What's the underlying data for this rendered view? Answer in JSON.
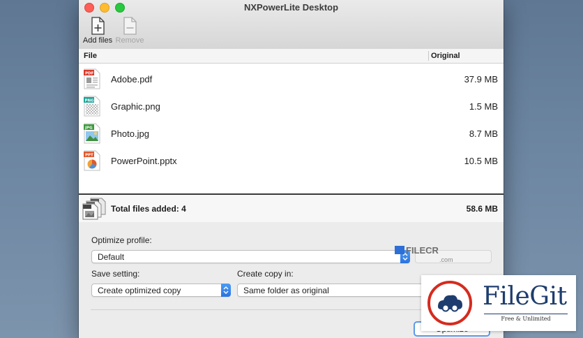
{
  "window": {
    "title": "NXPowerLite Desktop"
  },
  "toolbar": {
    "add_label": "Add files",
    "remove_label": "Remove"
  },
  "columns": {
    "file": "File",
    "original": "Original"
  },
  "files": [
    {
      "name": "Adobe.pdf",
      "size": "37.9 MB",
      "type": "PDF",
      "color": "#d93a2b"
    },
    {
      "name": "Graphic.png",
      "size": "1.5 MB",
      "type": "PNG",
      "color": "#1aa59a"
    },
    {
      "name": "Photo.jpg",
      "size": "8.7 MB",
      "type": "JPG",
      "color": "#3c9a3c"
    },
    {
      "name": "PowerPoint.pptx",
      "size": "10.5 MB",
      "type": "PPT",
      "color": "#e2572c"
    }
  ],
  "total": {
    "label": "Total files added: 4",
    "size": "58.6 MB"
  },
  "settings": {
    "profile_label": "Optimize profile:",
    "profile_value": "Default",
    "save_label": "Save setting:",
    "save_value": "Create optimized copy",
    "copy_label": "Create copy in:",
    "copy_value": "Same folder as original",
    "optimize_label": "Optimize"
  },
  "watermarks": {
    "filecr": "FILECR",
    "filecr_sub": ".com",
    "filegit_name": "FileGit",
    "filegit_tag": "Free & Unlimited"
  },
  "colors": {
    "accent": "#2a73e0",
    "filegit_blue": "#1e3d6e",
    "filegit_red": "#d52b1e"
  }
}
